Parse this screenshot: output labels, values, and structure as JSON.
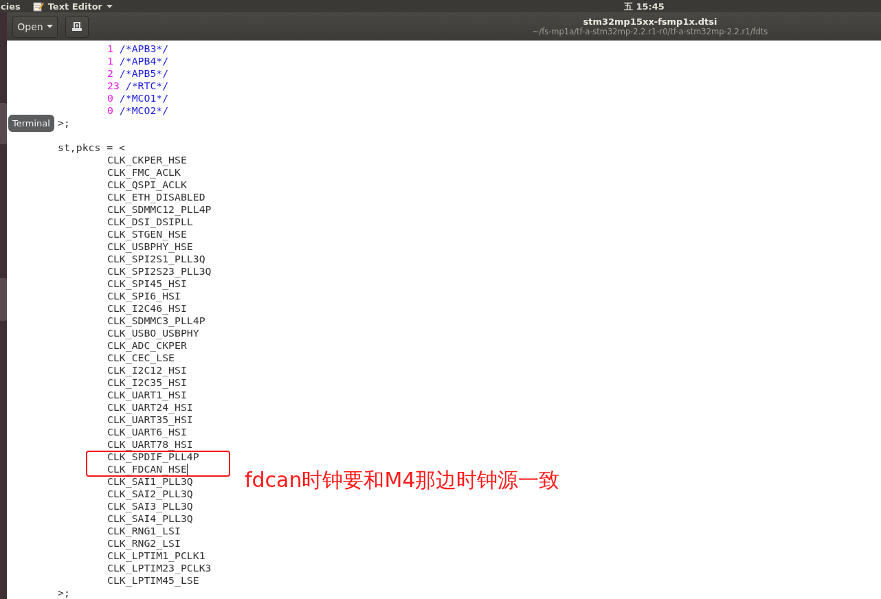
{
  "top_panel": {
    "activities": "cies",
    "app_menu": "Text Editor",
    "clock": "五 15:45"
  },
  "header": {
    "open_button": "Open",
    "title": "stm32mp15xx-fsmp1x.dtsi",
    "subtitle": "~/fs-mp1a/tf-a-stm32mp-2.2.r1-r0/tf-a-stm32mp-2.2.r1/fdts"
  },
  "tooltip": "Terminal",
  "lines": [
    {
      "kind": "value",
      "number": "1",
      "comment": "/*APB3*/",
      "cursor": false
    },
    {
      "kind": "value",
      "number": "1",
      "comment": "/*APB4*/",
      "cursor": false
    },
    {
      "kind": "value",
      "number": "2",
      "comment": "/*APB5*/",
      "cursor": false
    },
    {
      "kind": "value",
      "number": "23",
      "comment": "/*RTC*/",
      "cursor": false
    },
    {
      "kind": "value",
      "number": "0",
      "comment": "/*MCO1*/",
      "cursor": false
    },
    {
      "kind": "value",
      "number": "0",
      "comment": "/*MCO2*/",
      "cursor": false
    },
    {
      "kind": "statement",
      "text": ">;",
      "cursor": false
    },
    {
      "kind": "blank"
    },
    {
      "kind": "statement",
      "text": "st,pkcs = <",
      "cursor": false
    },
    {
      "kind": "item",
      "text": "CLK_CKPER_HSE",
      "cursor": false
    },
    {
      "kind": "item",
      "text": "CLK_FMC_ACLK",
      "cursor": false
    },
    {
      "kind": "item",
      "text": "CLK_QSPI_ACLK",
      "cursor": false
    },
    {
      "kind": "item",
      "text": "CLK_ETH_DISABLED",
      "cursor": false
    },
    {
      "kind": "item",
      "text": "CLK_SDMMC12_PLL4P",
      "cursor": false
    },
    {
      "kind": "item",
      "text": "CLK_DSI_DSIPLL",
      "cursor": false
    },
    {
      "kind": "item",
      "text": "CLK_STGEN_HSE",
      "cursor": false
    },
    {
      "kind": "item",
      "text": "CLK_USBPHY_HSE",
      "cursor": false
    },
    {
      "kind": "item",
      "text": "CLK_SPI2S1_PLL3Q",
      "cursor": false
    },
    {
      "kind": "item",
      "text": "CLK_SPI2S23_PLL3Q",
      "cursor": false
    },
    {
      "kind": "item",
      "text": "CLK_SPI45_HSI",
      "cursor": false
    },
    {
      "kind": "item",
      "text": "CLK_SPI6_HSI",
      "cursor": false
    },
    {
      "kind": "item",
      "text": "CLK_I2C46_HSI",
      "cursor": false
    },
    {
      "kind": "item",
      "text": "CLK_SDMMC3_PLL4P",
      "cursor": false
    },
    {
      "kind": "item",
      "text": "CLK_USBO_USBPHY",
      "cursor": false
    },
    {
      "kind": "item",
      "text": "CLK_ADC_CKPER",
      "cursor": false
    },
    {
      "kind": "item",
      "text": "CLK_CEC_LSE",
      "cursor": false
    },
    {
      "kind": "item",
      "text": "CLK_I2C12_HSI",
      "cursor": false
    },
    {
      "kind": "item",
      "text": "CLK_I2C35_HSI",
      "cursor": false
    },
    {
      "kind": "item",
      "text": "CLK_UART1_HSI",
      "cursor": false
    },
    {
      "kind": "item",
      "text": "CLK_UART24_HSI",
      "cursor": false
    },
    {
      "kind": "item",
      "text": "CLK_UART35_HSI",
      "cursor": false
    },
    {
      "kind": "item",
      "text": "CLK_UART6_HSI",
      "cursor": false
    },
    {
      "kind": "item",
      "text": "CLK_UART78_HSI",
      "cursor": false
    },
    {
      "kind": "item",
      "text": "CLK_SPDIF_PLL4P",
      "cursor": false
    },
    {
      "kind": "item",
      "text": "CLK_FDCAN_HSE",
      "cursor": true
    },
    {
      "kind": "item",
      "text": "CLK_SAI1_PLL3Q",
      "cursor": false
    },
    {
      "kind": "item",
      "text": "CLK_SAI2_PLL3Q",
      "cursor": false
    },
    {
      "kind": "item",
      "text": "CLK_SAI3_PLL3Q",
      "cursor": false
    },
    {
      "kind": "item",
      "text": "CLK_SAI4_PLL3Q",
      "cursor": false
    },
    {
      "kind": "item",
      "text": "CLK_RNG1_LSI",
      "cursor": false
    },
    {
      "kind": "item",
      "text": "CLK_RNG2_LSI",
      "cursor": false
    },
    {
      "kind": "item",
      "text": "CLK_LPTIM1_PCLK1",
      "cursor": false
    },
    {
      "kind": "item",
      "text": "CLK_LPTIM23_PCLK3",
      "cursor": false
    },
    {
      "kind": "item",
      "text": "CLK_LPTIM45_LSE",
      "cursor": false
    },
    {
      "kind": "statement",
      "text": ">;",
      "cursor": false
    }
  ],
  "annotation": {
    "text": "fdcan时钟要和M4那边时钟源一致"
  }
}
